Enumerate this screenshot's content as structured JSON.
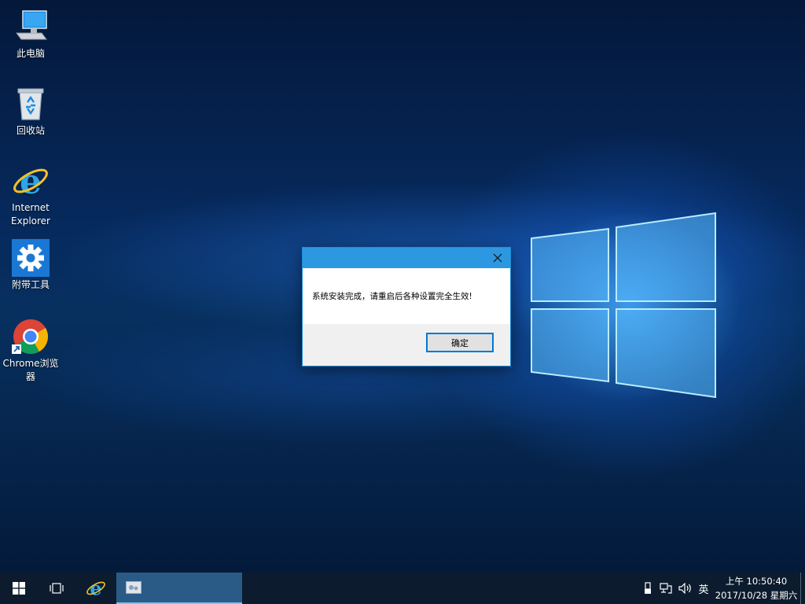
{
  "desktop": {
    "icons": [
      {
        "label": "此电脑",
        "icon": "computer-icon"
      },
      {
        "label": "回收站",
        "icon": "recycle-bin-icon"
      },
      {
        "label": "Internet Explorer",
        "icon": "internet-explorer-icon"
      },
      {
        "label": "附带工具",
        "icon": "gear-icon"
      },
      {
        "label": "Chrome浏览器",
        "icon": "chrome-icon"
      }
    ]
  },
  "dialog": {
    "message": "系统安装完成，请重启后各种设置完全生效!",
    "ok_label": "确定",
    "colors": {
      "titlebar": "#2d98e2",
      "border": "#1b90d9"
    }
  },
  "taskbar": {
    "language": "英",
    "time": "上午 10:50:40",
    "date": "2017/10/28 星期六",
    "colors": {
      "background": "#0c1c2e",
      "active_item": "#2a5b86"
    }
  }
}
